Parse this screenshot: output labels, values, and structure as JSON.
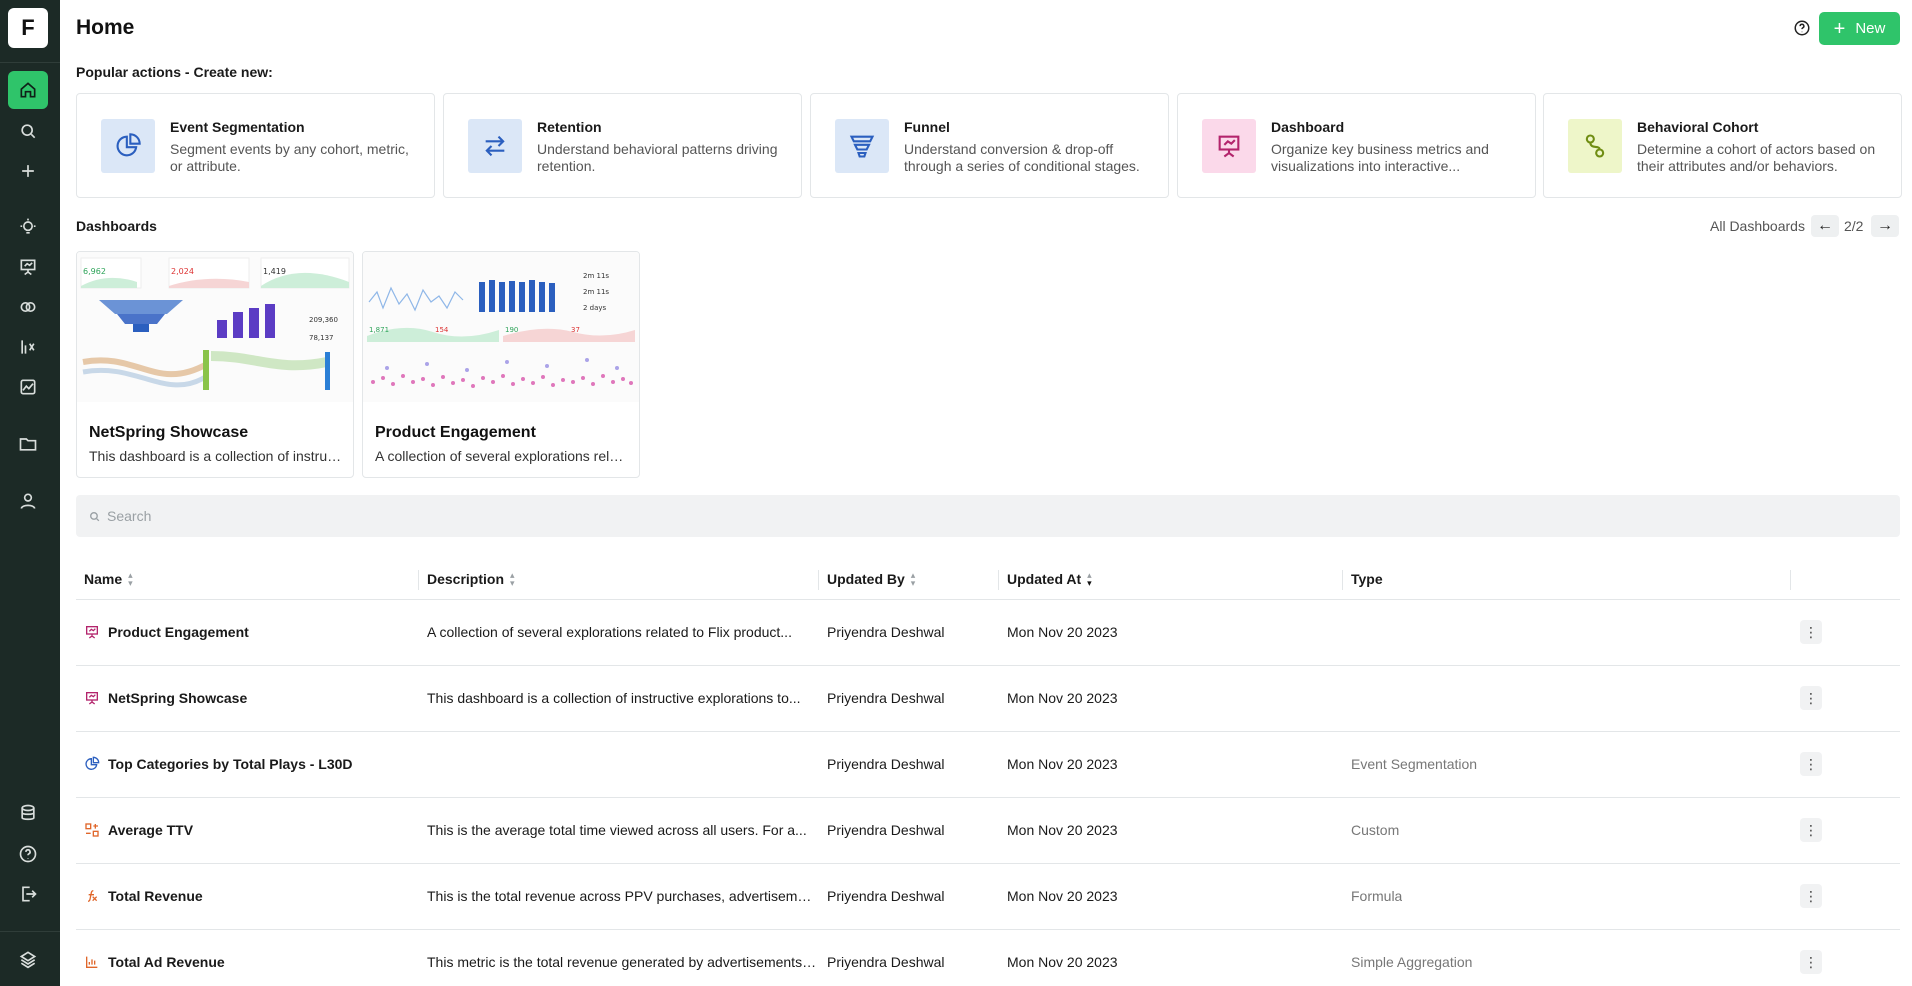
{
  "app": {
    "logo_letter": "F"
  },
  "header": {
    "title": "Home",
    "new_label": "New"
  },
  "popular": {
    "heading": "Popular actions - Create new:",
    "actions": [
      {
        "title": "Event Segmentation",
        "desc": "Segment events by any cohort, metric, or attribute.",
        "icon": "pie-chart-icon",
        "bg": "#dbe7f7",
        "color": "#2b5fbf"
      },
      {
        "title": "Retention",
        "desc": "Understand behavioral patterns driving retention.",
        "icon": "arrows-swap-icon",
        "bg": "#dbe7f7",
        "color": "#2b5fbf"
      },
      {
        "title": "Funnel",
        "desc": "Understand conversion & drop-off through a series of conditional stages.",
        "icon": "funnel-icon",
        "bg": "#dbe7f7",
        "color": "#2b5fbf"
      },
      {
        "title": "Dashboard",
        "desc": "Organize key business metrics and visualizations into interactive...",
        "icon": "presentation-icon",
        "bg": "#fbd9ea",
        "color": "#b3246c"
      },
      {
        "title": "Behavioral Cohort",
        "desc": "Determine a cohort of actors based on their attributes and/or behaviors.",
        "icon": "cohort-icon",
        "bg": "#eef6c9",
        "color": "#6f8d12"
      }
    ]
  },
  "dashboards": {
    "heading": "Dashboards",
    "all_label": "All Dashboards",
    "pager": "2/2",
    "items": [
      {
        "name": "NetSpring Showcase",
        "desc": "This dashboard is a collection of instructive explorations to..."
      },
      {
        "name": "Product Engagement",
        "desc": "A collection of several explorations related to Flix product..."
      }
    ]
  },
  "search": {
    "placeholder": "Search"
  },
  "table": {
    "columns": {
      "name": "Name",
      "description": "Description",
      "updated_by": "Updated By",
      "updated_at": "Updated At",
      "type": "Type"
    },
    "rows": [
      {
        "icon": "dashboard-icon",
        "name": "Product Engagement",
        "desc": "A collection of several explorations related to Flix product...",
        "by": "Priyendra Deshwal",
        "at": "Mon Nov 20 2023",
        "type": ""
      },
      {
        "icon": "dashboard-icon",
        "name": "NetSpring Showcase",
        "desc": "This dashboard is a collection of instructive explorations to...",
        "by": "Priyendra Deshwal",
        "at": "Mon Nov 20 2023",
        "type": ""
      },
      {
        "icon": "pie-chart-icon",
        "name": "Top Categories by Total Plays - L30D",
        "desc": "",
        "by": "Priyendra Deshwal",
        "at": "Mon Nov 20 2023",
        "type": "Event Segmentation"
      },
      {
        "icon": "custom-metric-icon",
        "name": "Average TTV",
        "desc": "This is the average total time viewed across all users. For a...",
        "by": "Priyendra Deshwal",
        "at": "Mon Nov 20 2023",
        "type": "Custom"
      },
      {
        "icon": "formula-icon",
        "name": "Total Revenue",
        "desc": "This is the total revenue across PPV purchases, advertisement...",
        "by": "Priyendra Deshwal",
        "at": "Mon Nov 20 2023",
        "type": "Formula"
      },
      {
        "icon": "aggregation-icon",
        "name": "Total Ad Revenue",
        "desc": "This metric is the total revenue generated by advertisements ...",
        "by": "Priyendra Deshwal",
        "at": "Mon Nov 20 2023",
        "type": "Simple Aggregation"
      }
    ]
  },
  "colors": {
    "accent": "#2fc46a",
    "sidebar": "#1c2a26"
  }
}
